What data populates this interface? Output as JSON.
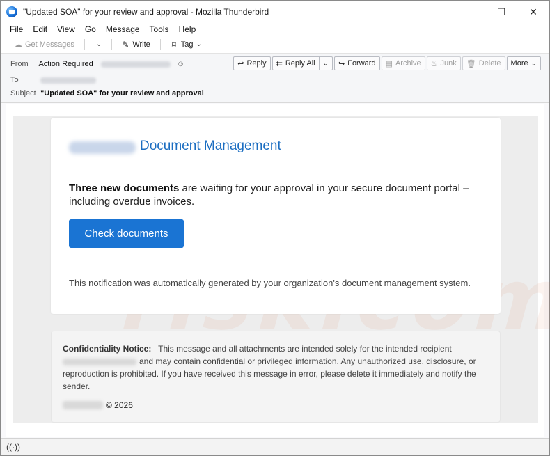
{
  "window": {
    "title": "\"Updated SOA\" for your review and approval - Mozilla Thunderbird",
    "controls": {
      "minimize": "—",
      "maximize": "☐",
      "close": "✕"
    }
  },
  "menu": [
    {
      "label": "File"
    },
    {
      "label": "Edit"
    },
    {
      "label": "View"
    },
    {
      "label": "Go"
    },
    {
      "label": "Message"
    },
    {
      "label": "Tools"
    },
    {
      "label": "Help"
    }
  ],
  "toolbar": {
    "get_messages": "Get Messages",
    "write": "Write",
    "tag": "Tag"
  },
  "header": {
    "from_label": "From",
    "from_name": "Action Required",
    "to_label": "To",
    "subject_label": "Subject",
    "subject": "\"Updated SOA\" for your review and approval",
    "actions": {
      "reply": "Reply",
      "reply_all": "Reply All",
      "forward": "Forward",
      "archive": "Archive",
      "junk": "Junk",
      "delete": "Delete",
      "more": "More"
    }
  },
  "email": {
    "title": "Document Management",
    "message_bold": "Three new documents",
    "message_rest": " are waiting for your approval in your secure document portal – including overdue invoices.",
    "button": "Check documents",
    "footer": "This notification was automatically generated by your organization's document management system.",
    "notice_label": "Confidentiality Notice:",
    "notice_line1": "This message and all attachments are intended solely for the intended recipient",
    "notice_rest": "and may contain confidential or privileged information. Any unauthorized use, disclosure, or reproduction is prohibited. If you have received this message in error, please delete it immediately and notify the sender.",
    "copyright": "© 2026"
  },
  "colors": {
    "accent": "#1b6dc1",
    "button": "#1a74d3"
  }
}
